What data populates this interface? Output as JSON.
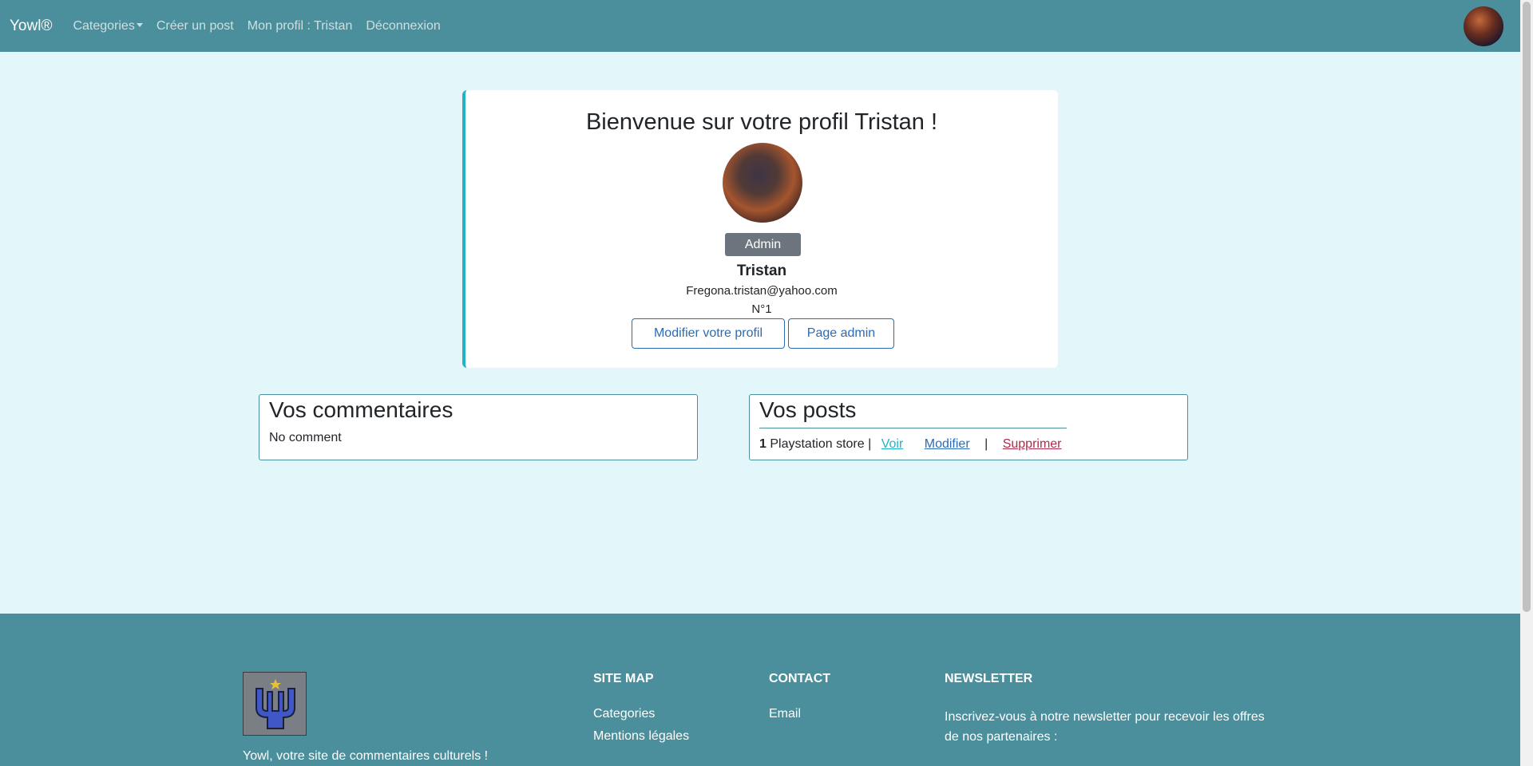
{
  "nav": {
    "brand": "Yowl®",
    "categories": "Categories",
    "create_post": "Créer un post",
    "profile": "Mon profil : Tristan",
    "logout": "Déconnexion"
  },
  "profile": {
    "title": "Bienvenue sur votre profil Tristan !",
    "role": "Admin",
    "name": "Tristan",
    "email": "Fregona.tristan@yahoo.com",
    "number": "N°1",
    "edit_button": "Modifier votre profil",
    "admin_button": "Page admin"
  },
  "comments": {
    "title": "Vos commentaires",
    "empty": "No comment"
  },
  "posts": {
    "title": "Vos posts",
    "items": [
      {
        "id": "1",
        "name": "Playstation store",
        "separator": "|",
        "view": "Voir",
        "edit": "Modifier",
        "sep": "|",
        "delete": "Supprimer"
      }
    ]
  },
  "footer": {
    "tagline": "Yowl, votre site de commentaires culturels !",
    "sitemap": {
      "title": "SITE MAP",
      "links": [
        "Categories",
        "Mentions légales"
      ]
    },
    "contact": {
      "title": "CONTACT",
      "links": [
        "Email"
      ]
    },
    "newsletter": {
      "title": "NEWSLETTER",
      "text": "Inscrivez-vous à notre newsletter pour recevoir les offres de nos partenaires :"
    }
  },
  "colors": {
    "navbar": "#4a8f9b",
    "page_bg": "#e3f6f9",
    "accent": "#24b3c4",
    "link": "#2b6bb5",
    "danger": "#b02a4a"
  }
}
